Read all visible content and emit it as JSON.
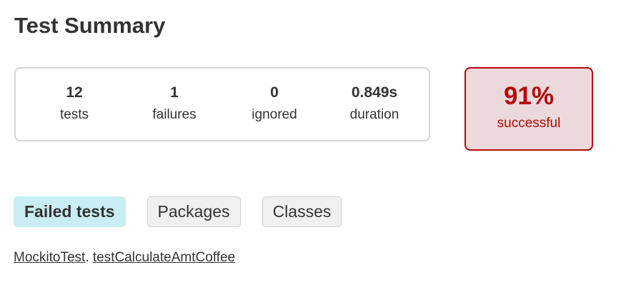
{
  "header": {
    "title": "Test Summary"
  },
  "counters": [
    {
      "value": "12",
      "label": "tests"
    },
    {
      "value": "1",
      "label": "failures"
    },
    {
      "value": "0",
      "label": "ignored"
    },
    {
      "value": "0.849s",
      "label": "duration"
    }
  ],
  "success_rate": {
    "percent": "91%",
    "label": "successful",
    "status_color": "#b60808",
    "background_color": "#ecd9db"
  },
  "tabs": [
    {
      "label": "Failed tests",
      "active": true
    },
    {
      "label": "Packages",
      "active": false
    },
    {
      "label": "Classes",
      "active": false
    }
  ],
  "failed_tests": [
    {
      "class_name": "MockitoTest",
      "separator": ".",
      "method_name": "testCalculateAmtCoffee"
    }
  ]
}
